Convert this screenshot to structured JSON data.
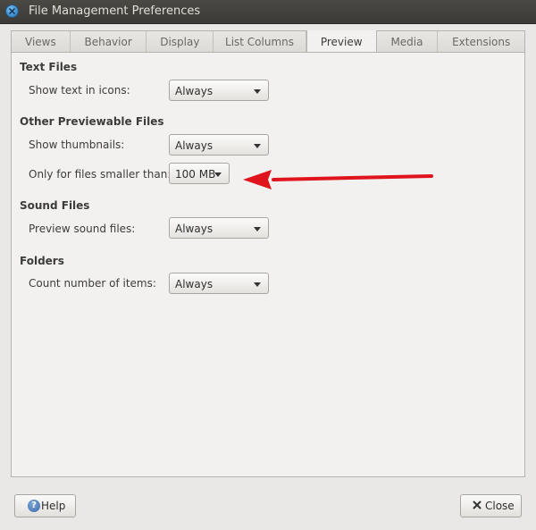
{
  "window": {
    "title": "File Management Preferences"
  },
  "tabs": [
    {
      "label": "Views"
    },
    {
      "label": "Behavior"
    },
    {
      "label": "Display"
    },
    {
      "label": "List Columns"
    },
    {
      "label": "Preview",
      "active": true
    },
    {
      "label": "Media"
    },
    {
      "label": "Extensions"
    }
  ],
  "sections": {
    "text_files": {
      "heading": "Text Files",
      "show_text_label": "Show text in icons:",
      "show_text_value": "Always"
    },
    "other_files": {
      "heading": "Other Previewable Files",
      "thumbnails_label": "Show thumbnails:",
      "thumbnails_value": "Always",
      "size_label": "Only for files smaller than:",
      "size_value": "100 MB"
    },
    "sound_files": {
      "heading": "Sound Files",
      "preview_label": "Preview sound files:",
      "preview_value": "Always"
    },
    "folders": {
      "heading": "Folders",
      "count_label": "Count number of items:",
      "count_value": "Always"
    }
  },
  "buttons": {
    "help": "Help",
    "close": "Close"
  },
  "icons": {
    "window_close": "close-icon",
    "help": "help-icon",
    "close": "x-icon",
    "arrow": "chevron-down-icon",
    "annotation": "red-arrow-icon"
  },
  "colors": {
    "annotation_arrow": "#e0141c",
    "titlebar": "#3b3a36",
    "close_button": "#3f8fd0"
  }
}
